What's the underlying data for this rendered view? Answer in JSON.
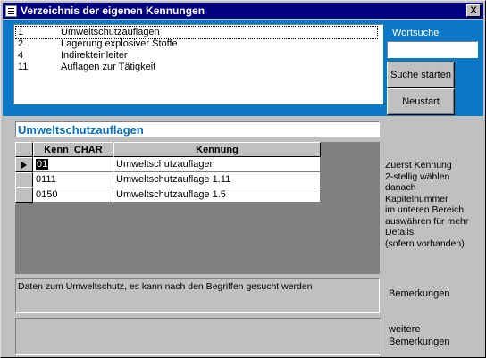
{
  "window": {
    "title": "Verzeichnis der eigenen Kennungen",
    "close_label": "X"
  },
  "list": {
    "items": [
      {
        "num": "1",
        "label": "Umweltschutzauflagen"
      },
      {
        "num": "2",
        "label": "Lagerung explosiver Stoffe"
      },
      {
        "num": "4",
        "label": "Indirekteinleiter"
      },
      {
        "num": "11",
        "label": "Auflagen zur Tätigkeit"
      }
    ]
  },
  "search": {
    "label": "Wortsuche",
    "value": "",
    "search_button": "Suche starten",
    "restart_button": "Neustart"
  },
  "detail": {
    "heading": "Umweltschutzauflagen"
  },
  "grid": {
    "columns": [
      "Kenn_CHAR",
      "Kennung"
    ],
    "rows": [
      {
        "kenn": "01",
        "kennung": "Umweltschutzauflagen"
      },
      {
        "kenn": "0111",
        "kennung": "Umweltschutzauflage 1.11"
      },
      {
        "kenn": "0150",
        "kennung": "Umweltschutzauflage 1.5"
      }
    ]
  },
  "hint": {
    "lines": [
      "Zuerst Kennung",
      "2-stellig wählen",
      "danach",
      "Kapitelnummer",
      "im unteren Bereich",
      "auswähren für mehr",
      "Details",
      "(sofern vorhanden)"
    ]
  },
  "remarks": {
    "text": "Daten zum Umweltschutz, es kann nach den Begriffen gesucht werden",
    "label": "Bemerkungen",
    "more_value": "",
    "more_label_1": "weitere",
    "more_label_2": "Bemerkungen"
  }
}
